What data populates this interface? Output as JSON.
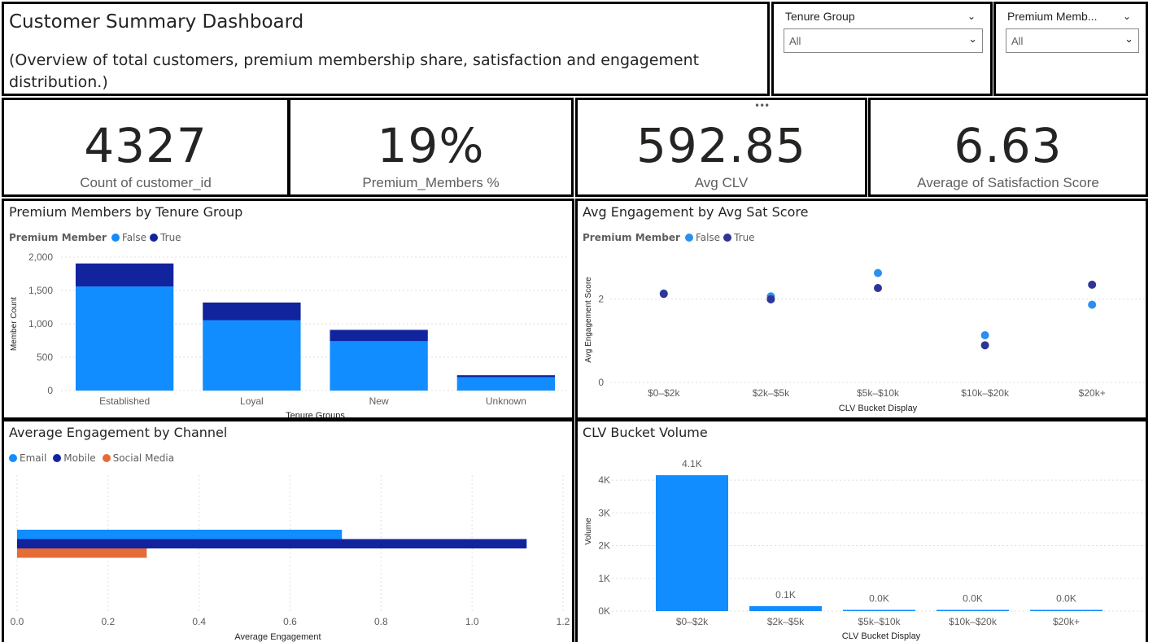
{
  "header": {
    "title": "Customer Summary Dashboard",
    "subtitle": "(Overview of total customers, premium membership share, satisfaction and engagement distribution.)"
  },
  "slicers": [
    {
      "title": "Tenure Group",
      "value": "All"
    },
    {
      "title": "Premium Memb...",
      "value": "All"
    }
  ],
  "kpis": [
    {
      "value": "4327",
      "label": "Count of customer_id"
    },
    {
      "value": "19%",
      "label": "Premium_Members %"
    },
    {
      "value": "592.85",
      "label": "Avg CLV"
    },
    {
      "value": "6.63",
      "label": "Average of Satisfaction Score"
    }
  ],
  "colors": {
    "light_blue": "#118dff",
    "dark_blue": "#12239e",
    "orange": "#e66c37",
    "scatter_light": "#2b8ff0",
    "scatter_dark": "#2f3597"
  },
  "more_icon": "ellipsis-icon",
  "chart_data": [
    {
      "id": "tenure",
      "type": "bar",
      "stacked": true,
      "title": "Premium Members by Tenure Group",
      "legend_title": "Premium Member",
      "categories": [
        "Established",
        "Loyal",
        "New",
        "Unknown"
      ],
      "series": [
        {
          "name": "False",
          "values": [
            1560,
            1055,
            740,
            200
          ]
        },
        {
          "name": "True",
          "values": [
            345,
            265,
            170,
            30
          ]
        }
      ],
      "xlabel": "Tenure Groups",
      "ylabel": "Member Count",
      "ylim": [
        0,
        2000
      ],
      "yticks": [
        0,
        500,
        1000,
        1500,
        2000
      ],
      "ytick_labels": [
        "0",
        "500",
        "1,000",
        "1,500",
        "2,000"
      ],
      "grid": true,
      "legend_position": "top-left"
    },
    {
      "id": "scatter",
      "type": "scatter",
      "title": "Avg Engagement by Avg Sat Score",
      "legend_title": "Premium Member",
      "categories": [
        "$0–$2k",
        "$2k–$5k",
        "$5k–$10k",
        "$10k–$20k",
        "$20k+"
      ],
      "series": [
        {
          "name": "False",
          "values": [
            2.13,
            2.06,
            2.62,
            1.13,
            1.86
          ]
        },
        {
          "name": "True",
          "values": [
            2.12,
            1.99,
            2.26,
            0.89,
            2.34
          ]
        }
      ],
      "xlabel": "CLV Bucket Display",
      "ylabel": "Avg Engagement Score",
      "ylim": [
        0,
        3
      ],
      "yticks": [
        0,
        2
      ],
      "ytick_labels": [
        "0",
        "2"
      ],
      "grid": true,
      "legend_position": "top-left"
    },
    {
      "id": "channel",
      "type": "bar",
      "orientation": "horizontal",
      "title": "Average Engagement by Channel",
      "series": [
        {
          "name": "Email",
          "values": [
            0.714
          ]
        },
        {
          "name": "Mobile",
          "values": [
            1.12
          ]
        },
        {
          "name": "Social Media",
          "values": [
            0.285
          ]
        }
      ],
      "xlabel": "Average Engagement",
      "xlim": [
        0,
        1.2
      ],
      "xticks": [
        0,
        0.2,
        0.4,
        0.6,
        0.8,
        1.0,
        1.2
      ],
      "xtick_labels": [
        "0.0",
        "0.2",
        "0.4",
        "0.6",
        "0.8",
        "1.0",
        "1.2"
      ],
      "grid": true,
      "legend_position": "top-left"
    },
    {
      "id": "clv",
      "type": "bar",
      "title": "CLV Bucket Volume",
      "categories": [
        "$0–$2k",
        "$2k–$5k",
        "$5k–$10k",
        "$10k–$20k",
        "$20k+"
      ],
      "values": [
        4150,
        150,
        15,
        8,
        4
      ],
      "data_labels": [
        "4.1K",
        "0.1K",
        "0.0K",
        "0.0K",
        "0.0K"
      ],
      "xlabel": "CLV Bucket Display",
      "ylabel": "Volume",
      "ylim": [
        0,
        4300
      ],
      "yticks": [
        0,
        1000,
        2000,
        3000,
        4000
      ],
      "ytick_labels": [
        "0K",
        "1K",
        "2K",
        "3K",
        "4K"
      ],
      "grid": true
    }
  ]
}
